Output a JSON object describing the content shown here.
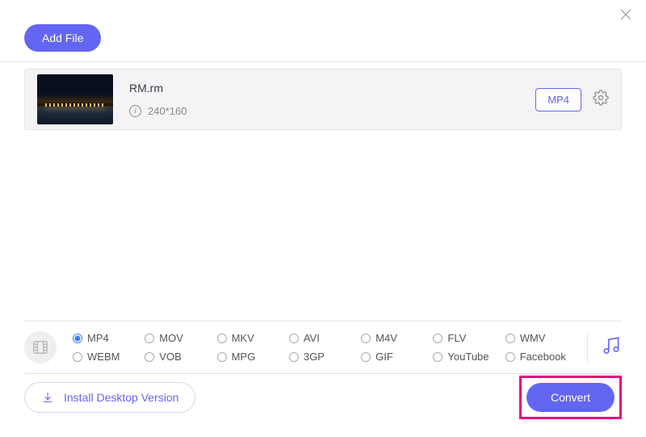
{
  "header": {
    "add_file_label": "Add File"
  },
  "file": {
    "name": "RM.rm",
    "resolution": "240*160",
    "target_format": "MP4"
  },
  "formats": {
    "row1": [
      {
        "key": "mp4",
        "label": "MP4",
        "selected": true
      },
      {
        "key": "mov",
        "label": "MOV",
        "selected": false
      },
      {
        "key": "mkv",
        "label": "MKV",
        "selected": false
      },
      {
        "key": "avi",
        "label": "AVI",
        "selected": false
      },
      {
        "key": "m4v",
        "label": "M4V",
        "selected": false
      },
      {
        "key": "flv",
        "label": "FLV",
        "selected": false
      },
      {
        "key": "wmv",
        "label": "WMV",
        "selected": false
      }
    ],
    "row2": [
      {
        "key": "webm",
        "label": "WEBM",
        "selected": false
      },
      {
        "key": "vob",
        "label": "VOB",
        "selected": false
      },
      {
        "key": "mpg",
        "label": "MPG",
        "selected": false
      },
      {
        "key": "3gp",
        "label": "3GP",
        "selected": false
      },
      {
        "key": "gif",
        "label": "GIF",
        "selected": false
      },
      {
        "key": "youtube",
        "label": "YouTube",
        "selected": false
      },
      {
        "key": "facebook",
        "label": "Facebook",
        "selected": false
      }
    ]
  },
  "footer": {
    "install_label": "Install Desktop Version",
    "convert_label": "Convert"
  }
}
